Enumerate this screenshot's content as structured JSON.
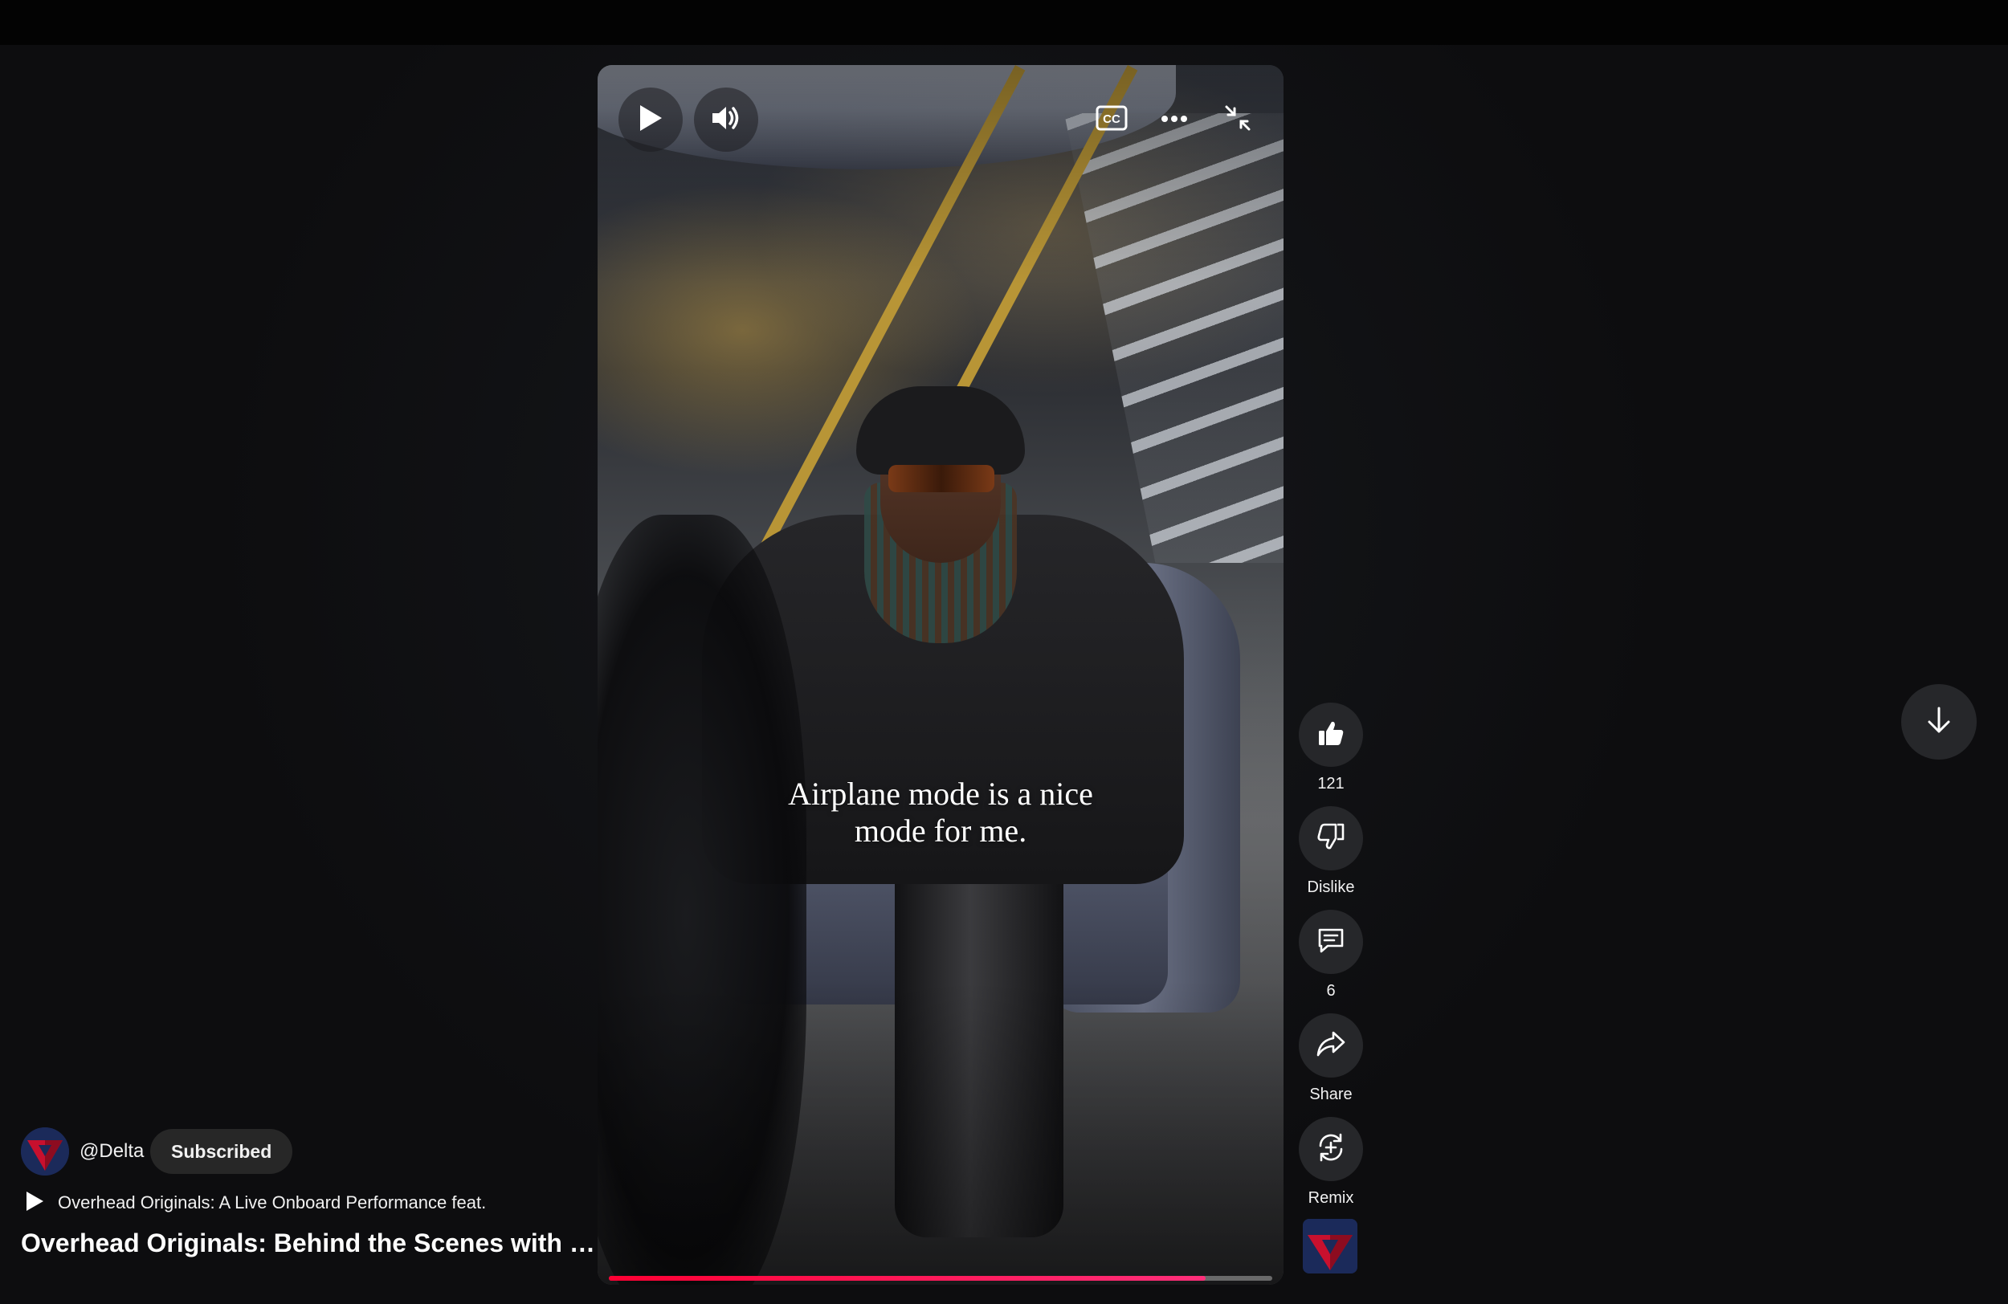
{
  "player": {
    "caption": "Airplane mode is a nice mode for me.",
    "progress_fraction": 0.9,
    "icons": {
      "play": "play-icon",
      "volume": "volume-icon",
      "captions": "closed-captions-icon",
      "more": "more-horizontal-icon",
      "collapse": "collapse-icon"
    }
  },
  "actions": {
    "like": {
      "label": "121",
      "icon": "thumbs-up-icon"
    },
    "dislike": {
      "label": "Dislike",
      "icon": "thumbs-down-icon"
    },
    "comments": {
      "label": "6",
      "icon": "comment-icon"
    },
    "share": {
      "label": "Share",
      "icon": "share-icon"
    },
    "remix": {
      "label": "Remix",
      "icon": "remix-icon"
    }
  },
  "channel": {
    "handle": "@Delta",
    "subscribe_label": "Subscribed"
  },
  "video": {
    "playlist_text": "Overhead Originals: A Live Onboard Performance feat.",
    "title": "Overhead Originals: Behind the Scenes with …"
  },
  "colors": {
    "background": "#0f0f11",
    "progress": "#ff0033",
    "button": "#26272a",
    "brand_red": "#c8102e",
    "brand_navy": "#1b2a5a"
  }
}
